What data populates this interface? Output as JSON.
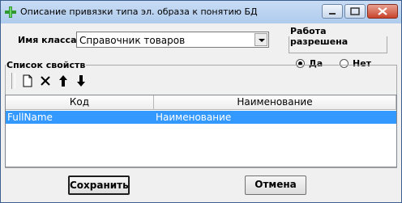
{
  "window": {
    "title": "Описание привязки типа эл. образа к понятию БД"
  },
  "form": {
    "class_label": "Имя класса",
    "class_value": "Справочник товаров",
    "work_permission": {
      "label": "Работа разрешена",
      "yes": "Да",
      "no": "Нет",
      "selected": "Да"
    }
  },
  "properties": {
    "label": "Список свойств",
    "toolbar_icons": [
      "new-document-icon",
      "delete-icon",
      "move-up-icon",
      "move-down-icon"
    ],
    "columns": [
      "Код",
      "Наименование"
    ],
    "rows": [
      {
        "code": "FullName",
        "name": "Наименование",
        "selected": true
      }
    ]
  },
  "buttons": {
    "save": "Сохранить",
    "cancel": "Отмена"
  },
  "colors": {
    "selection": "#3399ff",
    "titlebar": "#bcd4f0"
  }
}
